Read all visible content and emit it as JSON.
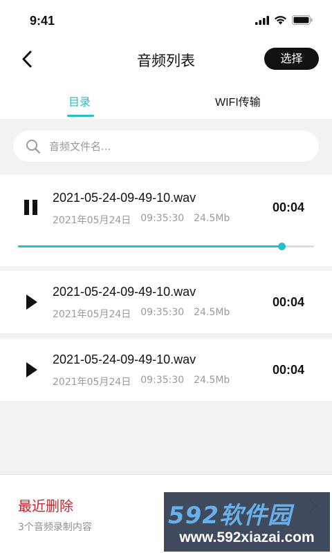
{
  "status_bar": {
    "time": "9:41"
  },
  "header": {
    "title": "音频列表",
    "select_label": "选择"
  },
  "tabs": [
    {
      "label": "目录",
      "active": true
    },
    {
      "label": "WIFI传输",
      "active": false
    }
  ],
  "search": {
    "placeholder": "音频文件名..."
  },
  "audio_items": [
    {
      "file_name": "2021-05-24-09-49-10.wav",
      "date": "2021年05月24日",
      "time": "09:35:30",
      "size": "24.5Mb",
      "duration": "00:04",
      "state": "playing",
      "progress": 0.89
    },
    {
      "file_name": "2021-05-24-09-49-10.wav",
      "date": "2021年05月24日",
      "time": "09:35:30",
      "size": "24.5Mb",
      "duration": "00:04",
      "state": "paused"
    },
    {
      "file_name": "2021-05-24-09-49-10.wav",
      "date": "2021年05月24日",
      "time": "09:35:30",
      "size": "24.5Mb",
      "duration": "00:04",
      "state": "paused"
    }
  ],
  "recent_deleted": {
    "title": "最近删除",
    "subtitle": "3个音频录制内容"
  },
  "watermark": {
    "brand": "592软件园",
    "url": "www.592xiazai.com"
  },
  "colors": {
    "accent": "#27bfc3",
    "danger": "#c2262b",
    "dark": "#111111"
  }
}
